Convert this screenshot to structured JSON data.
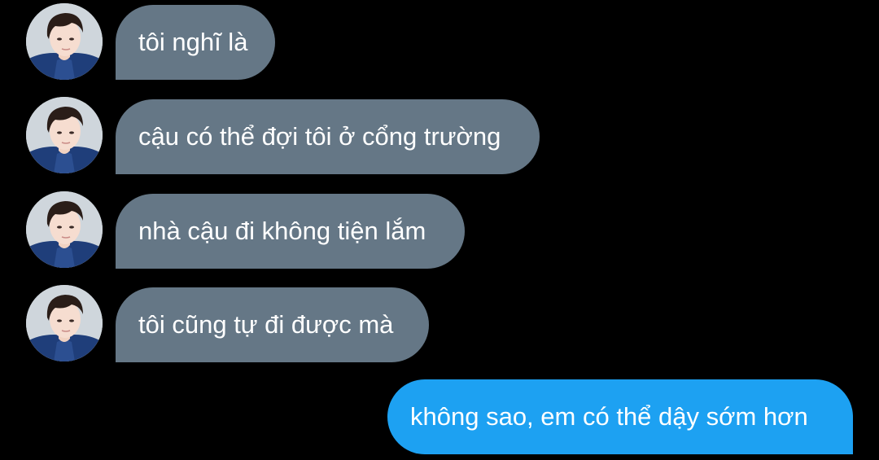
{
  "conversation": {
    "incoming_messages": [
      {
        "text": "tôi nghĩ là"
      },
      {
        "text": "cậu có thể đợi tôi ở cổng trường"
      },
      {
        "text": "nhà cậu đi không tiện lắm"
      },
      {
        "text": "tôi cũng tự đi được mà"
      }
    ],
    "outgoing_messages": [
      {
        "text": "không sao, em có thể dậy sớm hơn"
      }
    ]
  },
  "colors": {
    "background": "#000000",
    "incoming_bubble": "#657786",
    "outgoing_bubble": "#1da1f2",
    "text": "#ffffff"
  },
  "icons": {
    "sender_avatar": "avatar-photo"
  }
}
